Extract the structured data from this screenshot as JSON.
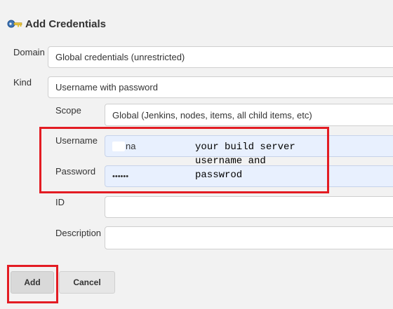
{
  "header": {
    "title": "Add Credentials",
    "icon": "key-icon"
  },
  "form": {
    "domain": {
      "label": "Domain",
      "value": "Global credentials (unrestricted)"
    },
    "kind": {
      "label": "Kind",
      "value": "Username with password"
    },
    "scope": {
      "label": "Scope",
      "value": "Global (Jenkins, nodes, items, all child items, etc)"
    },
    "username": {
      "label": "Username",
      "value": "na"
    },
    "password": {
      "label": "Password",
      "value": "••••••"
    },
    "id": {
      "label": "ID",
      "value": ""
    },
    "description": {
      "label": "Description",
      "value": ""
    }
  },
  "annotation": {
    "text": "your build server\nusername and\npasswrod",
    "color": "#e31c23"
  },
  "buttons": {
    "add": "Add",
    "cancel": "Cancel"
  }
}
